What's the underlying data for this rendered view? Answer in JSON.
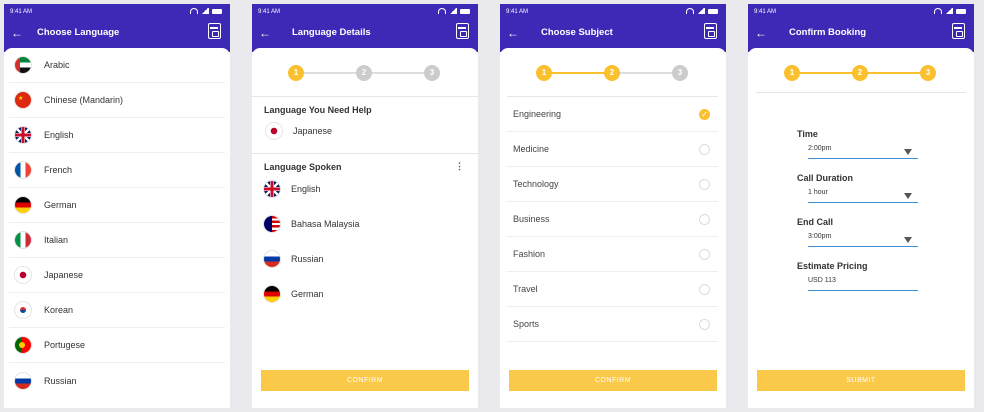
{
  "status_time": "9:41 AM",
  "screens": {
    "choose_language": {
      "title": "Choose Language",
      "languages": [
        "Arabic",
        "Chinese (Mandarin)",
        "English",
        "French",
        "German",
        "Italian",
        "Japanese",
        "Korean",
        "Portugese",
        "Russian"
      ]
    },
    "language_details": {
      "title": "Language Details",
      "steps": [
        "1",
        "2",
        "3"
      ],
      "need_help_heading": "Language You Need Help",
      "need_help_language": "Japanese",
      "spoken_heading": "Language Spoken",
      "spoken_languages": [
        "English",
        "Bahasa Malaysia",
        "Russian",
        "German"
      ],
      "button": "CONFIRM"
    },
    "choose_subject": {
      "title": "Choose Subject",
      "steps": [
        "1",
        "2",
        "3"
      ],
      "subjects": [
        "Engineering",
        "Medicine",
        "Technology",
        "Business",
        "Fashion",
        "Travel",
        "Sports"
      ],
      "selected": "Engineering",
      "button": "CONFIRM"
    },
    "confirm_booking": {
      "title": "Confirm Booking",
      "steps": [
        "1",
        "2",
        "3"
      ],
      "time_label": "Time",
      "time_value": "2:00pm",
      "duration_label": "Call Duration",
      "duration_value": "1 hour",
      "end_label": "End Call",
      "end_value": "3:00pm",
      "pricing_label": "Estimate Pricing",
      "pricing_value": "USD 113",
      "button": "SUBMIT"
    }
  },
  "colors": {
    "header": "#3c29b6",
    "accent": "#fbc02d",
    "field_underline": "#3f8fd2"
  },
  "icons": [
    "back-arrow-icon",
    "wallet-icon",
    "more-vertical-icon",
    "check-icon",
    "dropdown-arrow-icon"
  ]
}
